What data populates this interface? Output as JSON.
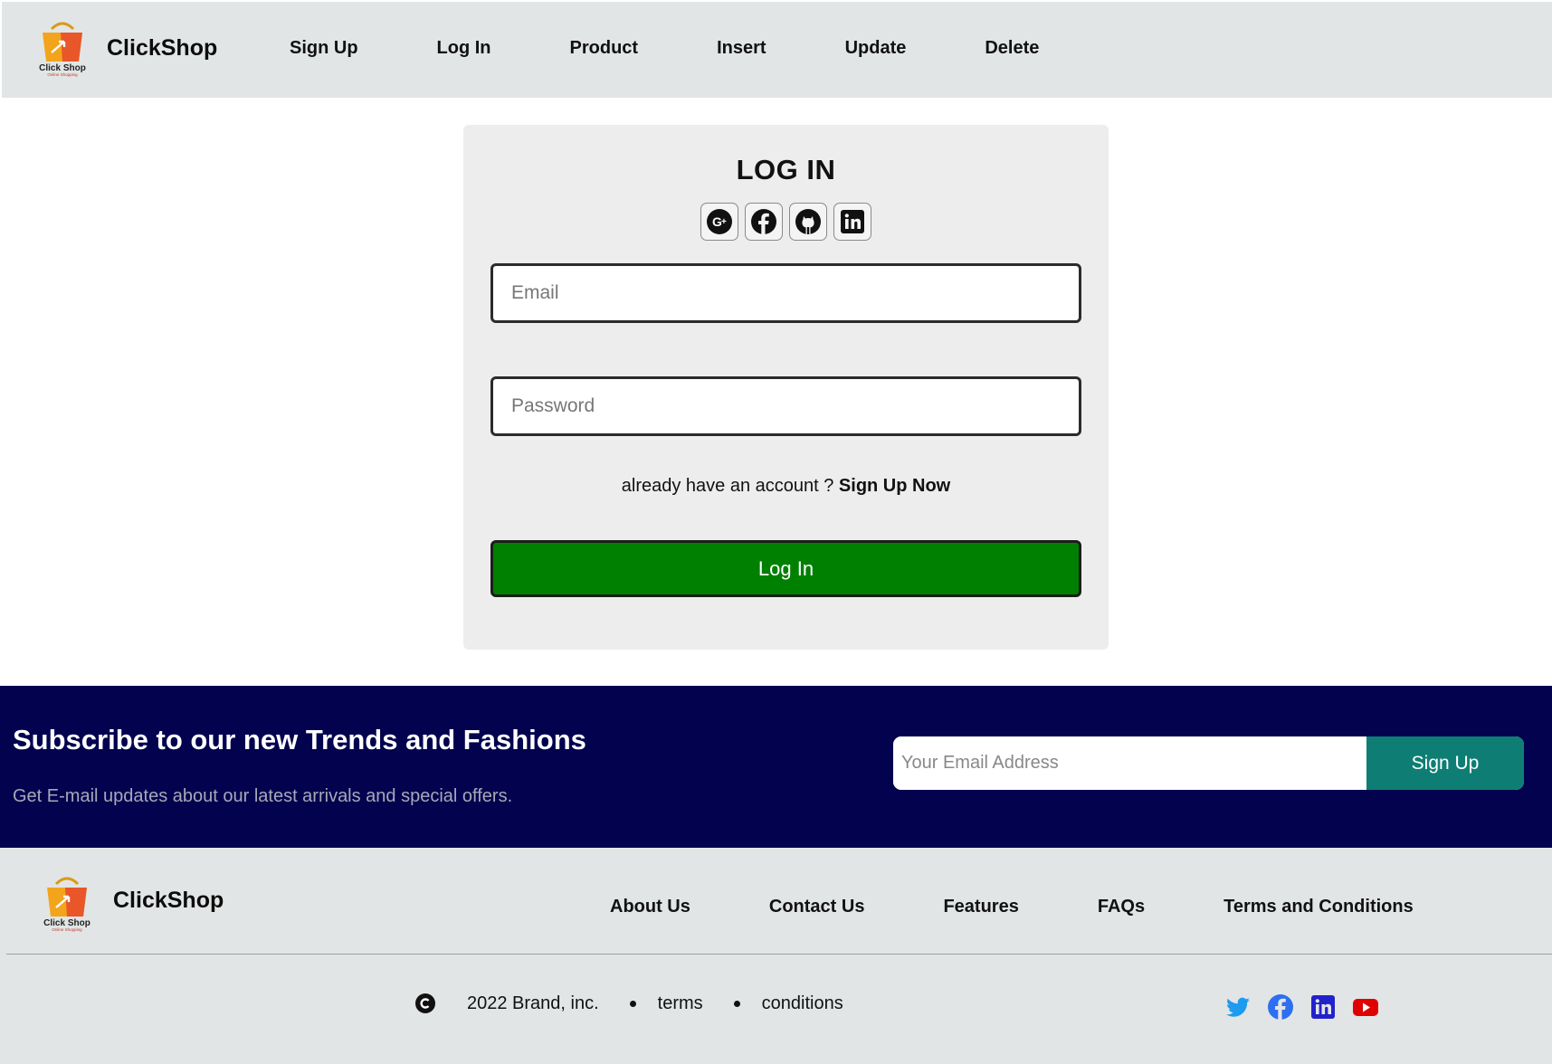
{
  "nav": {
    "brand": "ClickShop",
    "logo_caption": "Click Shop",
    "logo_subcaption": "Online Shopping",
    "links": [
      "Sign Up",
      "Log In",
      "Product",
      "Insert",
      "Update",
      "Delete"
    ]
  },
  "login": {
    "title": "LOG IN",
    "social_icons": [
      "google-plus-icon",
      "facebook-icon",
      "github-icon",
      "linkedin-icon"
    ],
    "email_placeholder": "Email",
    "password_placeholder": "Password",
    "account_prompt": "already have an account ? ",
    "account_link": "Sign Up Now",
    "submit_label": "Log In",
    "submit_color": "#008000"
  },
  "subscribe": {
    "title": "Subscribe to our new Trends and Fashions",
    "subtitle": "Get E-mail updates about our latest arrivals and special offers.",
    "email_placeholder": "Your Email Address",
    "button_label": "Sign Up",
    "background_color": "#02024f",
    "button_color": "#0e7e74"
  },
  "footer": {
    "brand": "ClickShop",
    "links": [
      "About Us",
      "Contact Us",
      "Features",
      "FAQs",
      "Terms and Conditions"
    ],
    "copyright": "2022 Brand, inc.",
    "legal_links": [
      "terms",
      "conditions"
    ],
    "social_icons": [
      "twitter-icon",
      "facebook-icon",
      "linkedin-icon",
      "youtube-icon"
    ]
  }
}
